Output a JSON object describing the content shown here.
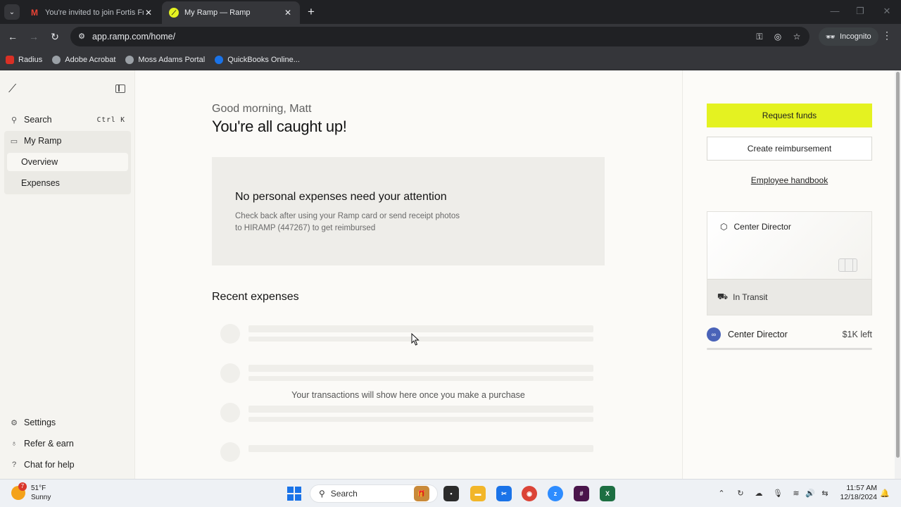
{
  "browser": {
    "tabs": [
      {
        "title": "You're invited to join Fortis Fran",
        "favicon": "gmail-icon",
        "active": false
      },
      {
        "title": "My Ramp — Ramp",
        "favicon": "ramp-icon",
        "active": true
      }
    ],
    "url": "app.ramp.com/home/",
    "incognito_label": "Incognito",
    "bookmarks": [
      {
        "label": "Radius",
        "color": "#d93025"
      },
      {
        "label": "Adobe Acrobat",
        "color": "#9aa0a6"
      },
      {
        "label": "Moss Adams Portal",
        "color": "#9aa0a6"
      },
      {
        "label": "QuickBooks Online...",
        "color": "#1a73e8"
      }
    ]
  },
  "sidebar": {
    "search_label": "Search",
    "search_shortcut": "Ctrl K",
    "my_ramp_label": "My Ramp",
    "sub_items": [
      {
        "label": "Overview",
        "selected": true
      },
      {
        "label": "Expenses",
        "selected": false
      }
    ],
    "footer": [
      {
        "label": "Settings",
        "icon": "gear-icon"
      },
      {
        "label": "Refer & earn",
        "icon": "gift-icon"
      },
      {
        "label": "Chat for help",
        "icon": "help-icon"
      }
    ]
  },
  "main": {
    "greeting": "Good morning, Matt",
    "headline": "You're all caught up!",
    "notice_title": "No personal expenses need your attention",
    "notice_body": "Check back after using your Ramp card or send receipt photos to HIRAMP (447267) to get reimbursed",
    "recent_title": "Recent expenses",
    "empty_message": "Your transactions will show here once you make a purchase"
  },
  "right": {
    "request_funds": "Request funds",
    "create_reimbursement": "Create reimbursement",
    "employee_handbook": "Employee handbook",
    "card_name": "Center Director",
    "card_status": "In Transit",
    "limit_name": "Center Director",
    "limit_left": "$1K left"
  },
  "taskbar": {
    "temp": "51°F",
    "condition": "Sunny",
    "badge": "7",
    "search_label": "Search",
    "time": "11:57 AM",
    "date": "12/18/2024"
  },
  "colors": {
    "accent": "#e4f221",
    "brand_blue": "#4a63b8"
  }
}
